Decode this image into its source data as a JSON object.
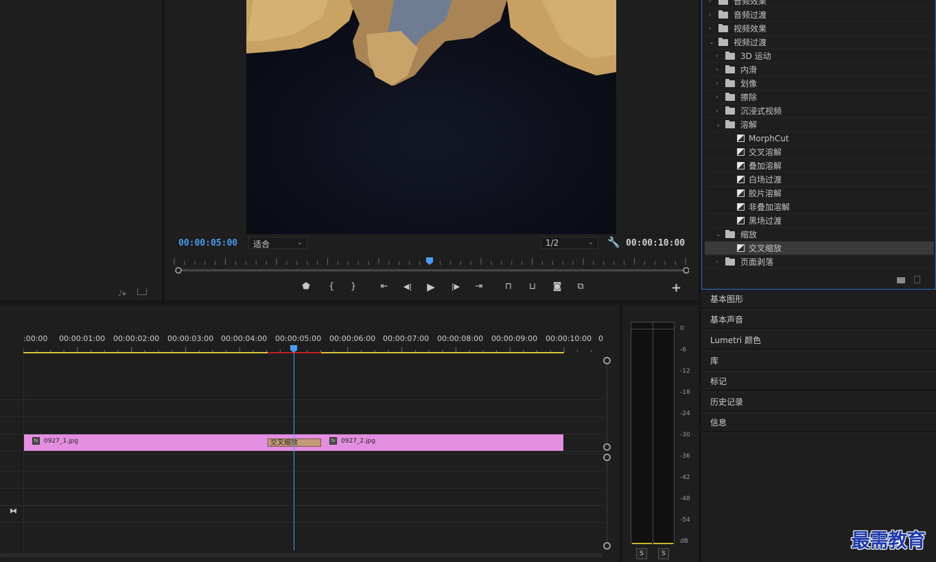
{
  "program_monitor": {
    "current_timecode": "00:00:05:00",
    "zoom_select": "适合",
    "resolution_select": "1/2",
    "duration_timecode": "00:00:10:00"
  },
  "transport": {
    "add_marker": "⬟",
    "mark_in": "{",
    "mark_out": "}",
    "go_to_in": "⇤",
    "step_back": "◀|",
    "play": "▶",
    "step_forward": "|▶",
    "go_to_out": "⇥",
    "lift": "⊓",
    "extract": "⊔",
    "export_frame": "◙",
    "compare": "⧉",
    "add_button": "+"
  },
  "effects_tree": {
    "rows": [
      {
        "label": "音频效果",
        "level": 0,
        "type": "folder",
        "expanded": false
      },
      {
        "label": "音频过渡",
        "level": 0,
        "type": "folder",
        "expanded": false
      },
      {
        "label": "视频效果",
        "level": 0,
        "type": "folder",
        "expanded": false
      },
      {
        "label": "视频过渡",
        "level": 0,
        "type": "folder",
        "expanded": true
      },
      {
        "label": "3D 运动",
        "level": 1,
        "type": "folder",
        "expanded": false
      },
      {
        "label": "内滑",
        "level": 1,
        "type": "folder",
        "expanded": false
      },
      {
        "label": "划像",
        "level": 1,
        "type": "folder",
        "expanded": false
      },
      {
        "label": "擦除",
        "level": 1,
        "type": "folder",
        "expanded": false
      },
      {
        "label": "沉浸式视频",
        "level": 1,
        "type": "folder",
        "expanded": false
      },
      {
        "label": "溶解",
        "level": 1,
        "type": "folder",
        "expanded": true
      },
      {
        "label": "MorphCut",
        "level": 2,
        "type": "effect"
      },
      {
        "label": "交叉溶解",
        "level": 2,
        "type": "effect"
      },
      {
        "label": "叠加溶解",
        "level": 2,
        "type": "effect"
      },
      {
        "label": "白场过渡",
        "level": 2,
        "type": "effect"
      },
      {
        "label": "胶片溶解",
        "level": 2,
        "type": "effect"
      },
      {
        "label": "非叠加溶解",
        "level": 2,
        "type": "effect"
      },
      {
        "label": "黑场过渡",
        "level": 2,
        "type": "effect"
      },
      {
        "label": "缩放",
        "level": 1,
        "type": "folder",
        "expanded": true
      },
      {
        "label": "交叉缩放",
        "level": 2,
        "type": "effect",
        "selected": true
      },
      {
        "label": "页面剥落",
        "level": 1,
        "type": "folder",
        "expanded": false
      }
    ]
  },
  "side_panels": [
    "基本图形",
    "基本声音",
    "Lumetri 颜色",
    "库",
    "标记",
    "历史记录",
    "信息"
  ],
  "timeline": {
    "ruler_labels": [
      ":00:00",
      "00:00:01:00",
      "00:00:02:00",
      "00:00:03:00",
      "00:00:04:00",
      "00:00:05:00",
      "00:00:06:00",
      "00:00:07:00",
      "00:00:08:00",
      "00:00:09:00",
      "00:00:10:00",
      "0"
    ],
    "clips": [
      {
        "name": "0927_1.jpg",
        "fx": "fx"
      },
      {
        "name": "0927_2.jpg",
        "fx": "fx"
      }
    ],
    "transition_label": "交叉缩放"
  },
  "audio_meter": {
    "db_labels": [
      "0",
      "-6",
      "-12",
      "-18",
      "-24",
      "-30",
      "-36",
      "-42",
      "-48",
      "-54",
      "dB"
    ],
    "solo_buttons": [
      "S",
      "S"
    ]
  },
  "watermark": "最需教育",
  "colors": {
    "accent_blue": "#2b6fc7",
    "timecode_blue": "#4b9cf0",
    "clip_pink": "#e38ee0",
    "transition_tan": "#c49a7a",
    "work_area_yellow": "#d8c83a",
    "render_red": "#c02020"
  }
}
